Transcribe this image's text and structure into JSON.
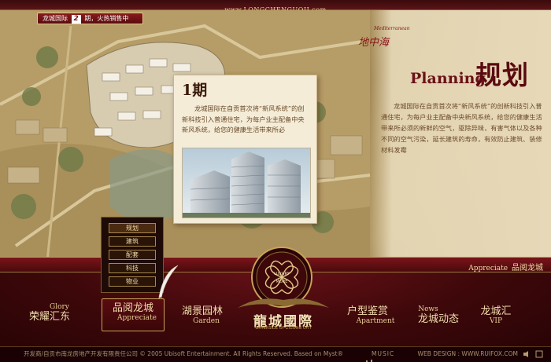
{
  "site": {
    "url": "www.LONGCHENGUOJI.com"
  },
  "badge": {
    "prefix": "龙城国际",
    "number": "2",
    "suffix": "期，火热销售中"
  },
  "brand": {
    "en": "Mediterranean",
    "zh": "地中海"
  },
  "planning": {
    "heading_en": "Planning",
    "heading_zh": "规划",
    "description": "龙城国际在自贡首次将“新风系统”的创新科技引入普通住宅，为每户业主配备中央新风系统，给您的健康生活带来所必须的新鲜的空气，驱除异味，有害气体以及各种不同的空气污染，延长建筑的寿命，有效防止建筑、装修材料发霉"
  },
  "card": {
    "title": "1期",
    "body": "龙城国际在自贡首次将“新风系统”的创新科技引入普通住宅，为每户业主配备中央新风系统，给您的健康生活带来所必"
  },
  "submenu": {
    "items": [
      {
        "label": "规划"
      },
      {
        "label": "建筑"
      },
      {
        "label": "配套"
      },
      {
        "label": "科技"
      },
      {
        "label": "物业"
      }
    ]
  },
  "appreciate_tag": {
    "en": "Appreciate",
    "zh": "品阅龙城"
  },
  "nav": {
    "items": [
      {
        "en": "Glory",
        "zh": "荣耀汇东"
      },
      {
        "en": "Appreciate",
        "zh": "品阅龙城"
      },
      {
        "en": "Garden",
        "zh": "湖景园林"
      },
      {
        "en": "Apartment",
        "zh": "户型鉴赏"
      },
      {
        "en": "News",
        "zh": "龙城动态"
      },
      {
        "en": "VIP",
        "zh": "龙城汇"
      }
    ]
  },
  "logo": {
    "zh": "龍城國際",
    "medal_top": "LUXURY",
    "medal_bottom": "MORE",
    "sub": "WATERSIDE OF ZIGONG CITY"
  },
  "footer": {
    "copyright": "开发商/自贡市南龙房地产开发有限责任公司 © 2005 Ubisoft Entertainment. All Rights Reserved. Based on Myst®",
    "music": "MUSIC",
    "design": "WEB DESIGN : WWW.RUIFOX.COM"
  },
  "colors": {
    "brand_red": "#7a1214",
    "gold": "#c9a25a",
    "paper": "#e7d9b8"
  }
}
